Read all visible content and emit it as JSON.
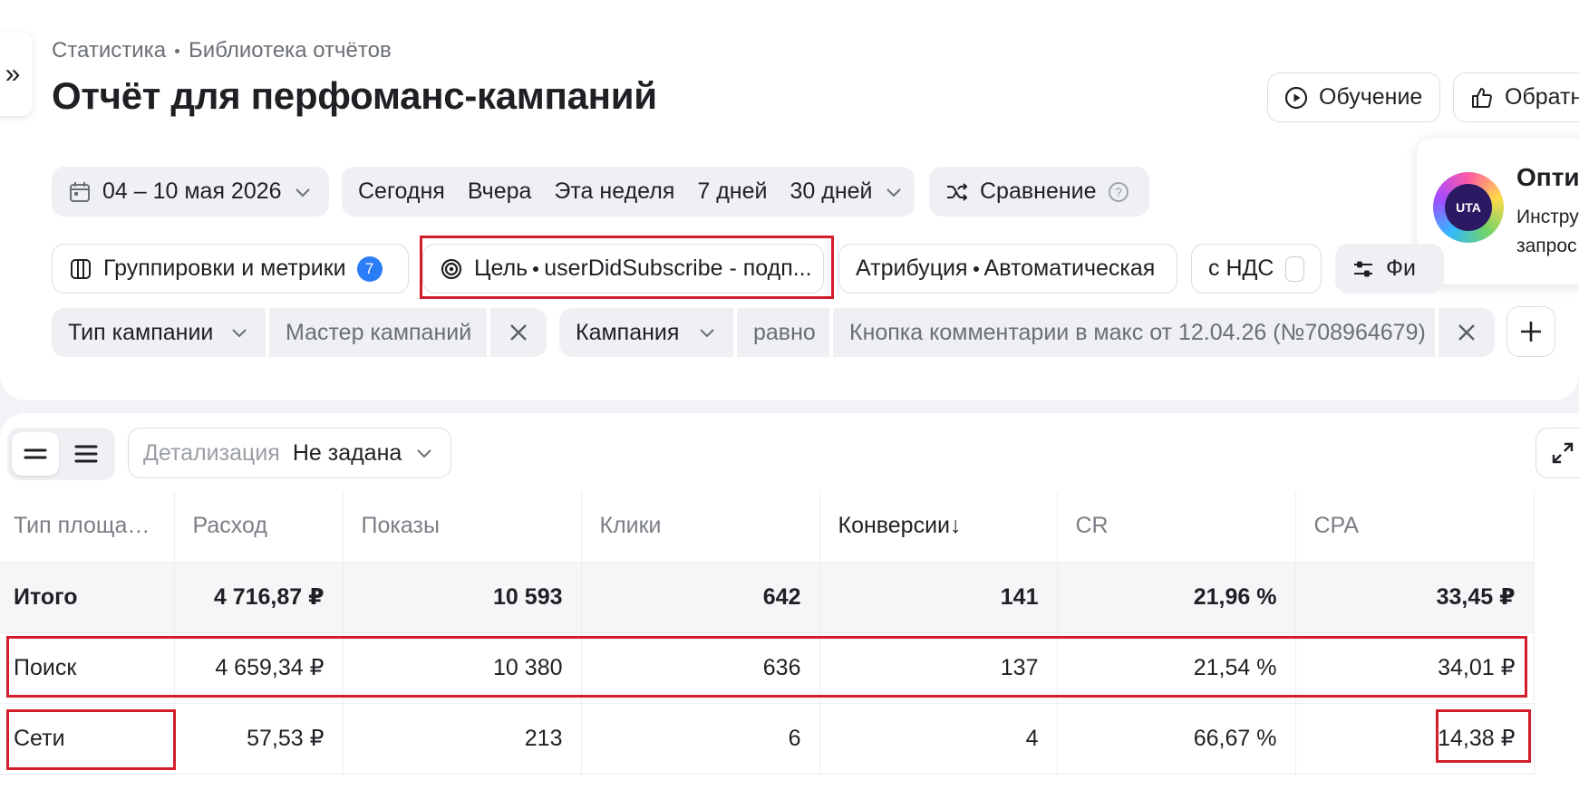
{
  "breadcrumb": {
    "root": "Статистика",
    "current": "Библиотека отчётов"
  },
  "title": "Отчёт для перфоманс-кампаний",
  "header_buttons": {
    "learn": "Обучение",
    "feedback": "Обратн"
  },
  "promo": {
    "title": "Опти",
    "line1": "Инстру",
    "line2": "запрос",
    "logo_text": "UTA"
  },
  "date_range": "04 – 10 мая 2026",
  "quick_periods": [
    "Сегодня",
    "Вчера",
    "Эта неделя",
    "7 дней",
    "30 дней"
  ],
  "compare_label": "Сравнение",
  "groupings": {
    "label": "Группировки и метрики",
    "count": "7"
  },
  "goal": {
    "prefix": "Цель",
    "value": "userDidSubscribe - подп..."
  },
  "attribution": {
    "prefix": "Атрибуция",
    "value": "Автоматическая"
  },
  "vat_label": "с НДС",
  "filters_label": "Фи",
  "filters": [
    {
      "field": "Тип кампании",
      "value": "Мастер кампаний"
    },
    {
      "field": "Кампания",
      "operator": "равно",
      "value": "Кнопка комментарии в макс от 12.04.26 (№708964679)"
    }
  ],
  "detail": {
    "label": "Детализация",
    "value": "Не задана"
  },
  "table": {
    "columns": [
      "Тип площад...",
      "Расход",
      "Показы",
      "Клики",
      "Конверсии",
      "CR",
      "CPA"
    ],
    "sort_arrow": "↓",
    "total": [
      "Итого",
      "4 716,87 ₽",
      "10 593",
      "642",
      "141",
      "21,96 %",
      "33,45 ₽"
    ],
    "rows": [
      [
        "Поиск",
        "4 659,34 ₽",
        "10 380",
        "636",
        "137",
        "21,54 %",
        "34,01 ₽"
      ],
      [
        "Сети",
        "57,53 ₽",
        "213",
        "6",
        "4",
        "66,67 %",
        "14,38 ₽"
      ]
    ]
  },
  "colors": {
    "accent_blue": "#2b7cf7",
    "highlight_red": "#d11e2a",
    "background": "#f1f3f6"
  }
}
